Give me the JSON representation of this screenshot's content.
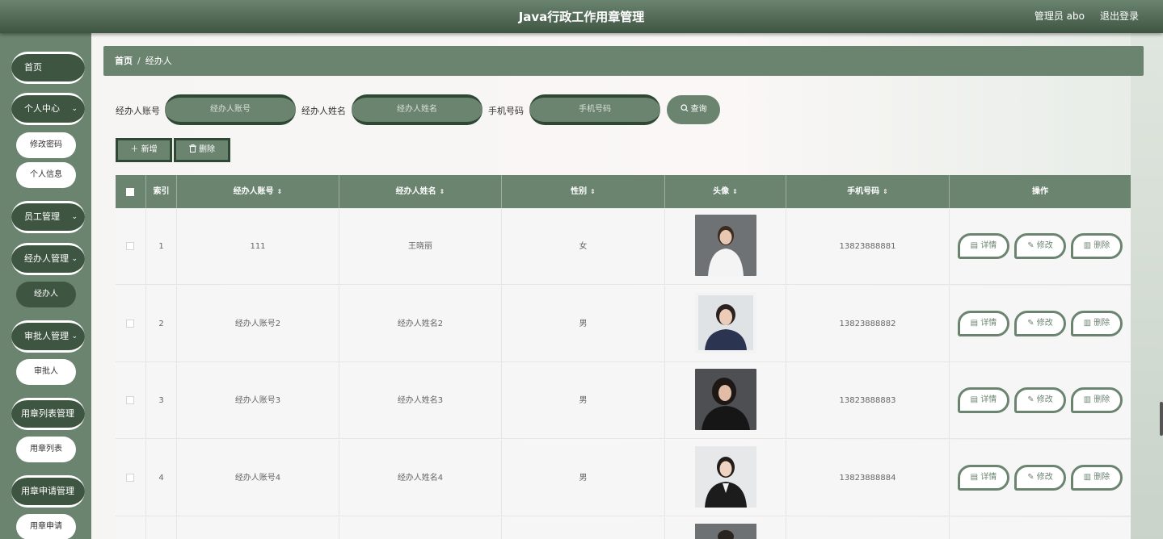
{
  "header": {
    "title": "Java行政工作用章管理",
    "user": "管理员 abo",
    "logout": "退出登录"
  },
  "sidebar": {
    "items": [
      {
        "label": "首页"
      },
      {
        "label": "个人中心",
        "chevron": "⌄"
      },
      {
        "label": "修改密码"
      },
      {
        "label": "个人信息"
      },
      {
        "label": "员工管理",
        "chevron": "⌄"
      },
      {
        "label": "经办人管理",
        "chevron": "⌄"
      },
      {
        "label": "经办人"
      },
      {
        "label": "审批人管理",
        "chevron": "⌄"
      },
      {
        "label": "审批人"
      },
      {
        "label": "用章列表管理",
        "chevron": "⌄"
      },
      {
        "label": "用章列表"
      },
      {
        "label": "用章申请管理",
        "chevron": "⌄"
      },
      {
        "label": "用章申请"
      }
    ]
  },
  "breadcrumb": {
    "home": "首页",
    "separator": "/",
    "current": "经办人"
  },
  "search": {
    "account_label": "经办人账号",
    "account_placeholder": "经办人账号",
    "name_label": "经办人姓名",
    "name_placeholder": "经办人姓名",
    "phone_label": "手机号码",
    "phone_placeholder": "手机号码",
    "query_label": "查询"
  },
  "actions": {
    "add_label": "新增",
    "delete_label": "删除"
  },
  "table": {
    "columns": [
      "索引",
      "经办人账号",
      "经办人姓名",
      "性别",
      "头像",
      "手机号码",
      "操作"
    ],
    "sort_glyph": "⇕",
    "rows": [
      {
        "index": "1",
        "account": "111",
        "name": "王晓丽",
        "gender": "女",
        "phone": "13823888881"
      },
      {
        "index": "2",
        "account": "经办人账号2",
        "name": "经办人姓名2",
        "gender": "男",
        "phone": "13823888882"
      },
      {
        "index": "3",
        "account": "经办人账号3",
        "name": "经办人姓名3",
        "gender": "男",
        "phone": "13823888883"
      },
      {
        "index": "4",
        "account": "经办人账号4",
        "name": "经办人姓名4",
        "gender": "男",
        "phone": "13823888884"
      }
    ],
    "ops": {
      "detail": "详情",
      "edit": "修改",
      "delete": "删除"
    }
  },
  "colors": {
    "primary": "#6b8470",
    "dark": "#3e5542",
    "border": "#2f4834"
  }
}
